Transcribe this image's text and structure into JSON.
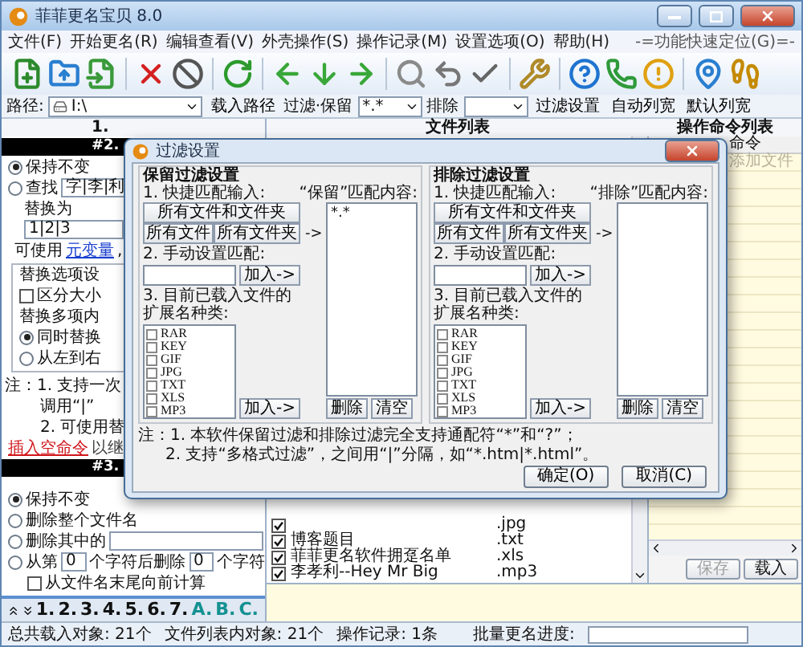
{
  "window": {
    "title": "菲菲更名宝贝 8.0"
  },
  "menu": {
    "items": [
      "文件(F)",
      "开始更名(R)",
      "编辑查看(V)",
      "外壳操作(S)",
      "操作记录(M)",
      "设置选项(O)",
      "帮助(H)"
    ],
    "locator": "-=功能快速定位(G)=-"
  },
  "path_bar": {
    "path_label": "路径:",
    "path_value": "I:\\",
    "load_button": "载入路径",
    "filter_label": "过滤·保留",
    "keep_value": "*.*",
    "exclude_label": "排除",
    "filter_settings_button": "过滤设置",
    "auto_width_button": "自动列宽",
    "default_width_button": "默认列宽"
  },
  "left_panel": {
    "heading": "1.",
    "section_2": {
      "header": "#2.",
      "options": [
        {
          "label": "保持不变",
          "selected": true,
          "kind": "plain"
        },
        {
          "label": "查找",
          "selected": false,
          "kind": "find"
        }
      ],
      "find_value": "字|李|利",
      "replace_label": "替换为",
      "replace_value": "1|2|3",
      "hint": "可使用",
      "hint_link": "元变量",
      "hint_suffix": ",",
      "options_group": {
        "title": "替换选项设",
        "case_label": "区分大小",
        "case_checked": false,
        "multi_label": "替换多项内",
        "multi_options": [
          {
            "label": "同时替换",
            "selected": true
          },
          {
            "label": "从左到右",
            "selected": false
          }
        ]
      },
      "notes": [
        "注：1. 支持一次",
        "调用“|”",
        "2. 可使用替"
      ],
      "insert_link": "插入空命令",
      "insert_suffix": "以继"
    },
    "section_3": {
      "header": "#3.",
      "options": [
        {
          "label": "保持不变",
          "selected": true,
          "kind": "plain"
        },
        {
          "label": "删除整个文件名",
          "selected": false,
          "kind": "plain"
        },
        {
          "label": "删除其中的",
          "selected": false,
          "kind": "field"
        },
        {
          "label": "从第",
          "selected": false,
          "kind": "range"
        }
      ],
      "from_value": "0",
      "mid_label": "个字符后删除",
      "count_value": "0",
      "end_label": "个字符",
      "from_end_label": "从文件名末尾向前计算",
      "from_end_checked": false
    },
    "tabs": [
      {
        "label": "1.",
        "kind": "number"
      },
      {
        "label": "2.",
        "kind": "number"
      },
      {
        "label": "3.",
        "kind": "number"
      },
      {
        "label": "4.",
        "kind": "number"
      },
      {
        "label": "5.",
        "kind": "number"
      },
      {
        "label": "6.",
        "kind": "number"
      },
      {
        "label": "7.",
        "kind": "number"
      },
      {
        "label": "A.",
        "kind": "letter"
      },
      {
        "label": "B.",
        "kind": "letter"
      },
      {
        "label": "C.",
        "kind": "letter"
      }
    ]
  },
  "file_list": {
    "heading": "文件列表",
    "rows": [
      {
        "ext": ".jpg",
        "checked": true
      },
      {
        "name": "博客题目",
        "ext": ".txt",
        "checked": true
      },
      {
        "name": "菲菲更名软件拥趸名单",
        "ext": ".xls",
        "checked": true
      },
      {
        "name": "李孝利--Hey Mr Big",
        "ext": ".mp3",
        "checked": true
      }
    ]
  },
  "command_list": {
    "heading": "操作命令列表",
    "column": "命令",
    "placeholder": "添加文件",
    "save_button": "保存",
    "save_disabled": true,
    "load_button": "载入"
  },
  "status_bar": {
    "total": "总共载入对象: 21个",
    "in_list": "文件列表内对象: 21个",
    "history": "操作记录: 1条",
    "progress_label": "批量更名进度:",
    "level": 0
  },
  "dialog": {
    "title": "过滤设置",
    "groups": [
      {
        "title": "保留过滤设置",
        "quick_label": "1. 快捷匹配输入:",
        "quick_buttons": [
          "所有文件和文件夹",
          "所有文件",
          "所有文件夹"
        ],
        "arrow": "->",
        "manual_label": "2. 手动设置匹配:",
        "add_button": "加入->",
        "ext_label": "3. 目前已载入文件的扩展名种类:",
        "extensions": [
          {
            "name": "RAR",
            "checked": false
          },
          {
            "name": "KEY",
            "checked": false
          },
          {
            "name": "GIF",
            "checked": false
          },
          {
            "name": "JPG",
            "checked": false
          },
          {
            "name": "TXT",
            "checked": false
          },
          {
            "name": "XLS",
            "checked": false
          },
          {
            "name": "MP3",
            "checked": false
          }
        ],
        "add_button_2": "加入->",
        "list_title": "“保留”匹配内容:",
        "list_items": [
          "*.*"
        ],
        "delete_button": "删除",
        "clear_button": "清空"
      },
      {
        "title": "排除过滤设置",
        "quick_label": "1. 快捷匹配输入:",
        "quick_buttons": [
          "所有文件和文件夹",
          "所有文件",
          "所有文件夹"
        ],
        "arrow": "->",
        "manual_label": "2. 手动设置匹配:",
        "add_button": "加入->",
        "ext_label": "3. 目前已载入文件的扩展名种类:",
        "extensions": [
          {
            "name": "RAR",
            "checked": false
          },
          {
            "name": "KEY",
            "checked": false
          },
          {
            "name": "GIF",
            "checked": false
          },
          {
            "name": "JPG",
            "checked": false
          },
          {
            "name": "TXT",
            "checked": false
          },
          {
            "name": "XLS",
            "checked": false
          },
          {
            "name": "MP3",
            "checked": false
          }
        ],
        "add_button_2": "加入->",
        "list_title": "“排除”匹配内容:",
        "delete_button": "删除",
        "clear_button": "清空"
      }
    ],
    "notes": [
      "注：1. 本软件保留过滤和排除过滤完全支持通配符“*”和“?”；",
      "2. 支持“多格式过滤”，之间用“|”分隔，如“*.htm|*.html”。"
    ],
    "ok_button": "确定(O)",
    "cancel_button": "取消(C)"
  }
}
